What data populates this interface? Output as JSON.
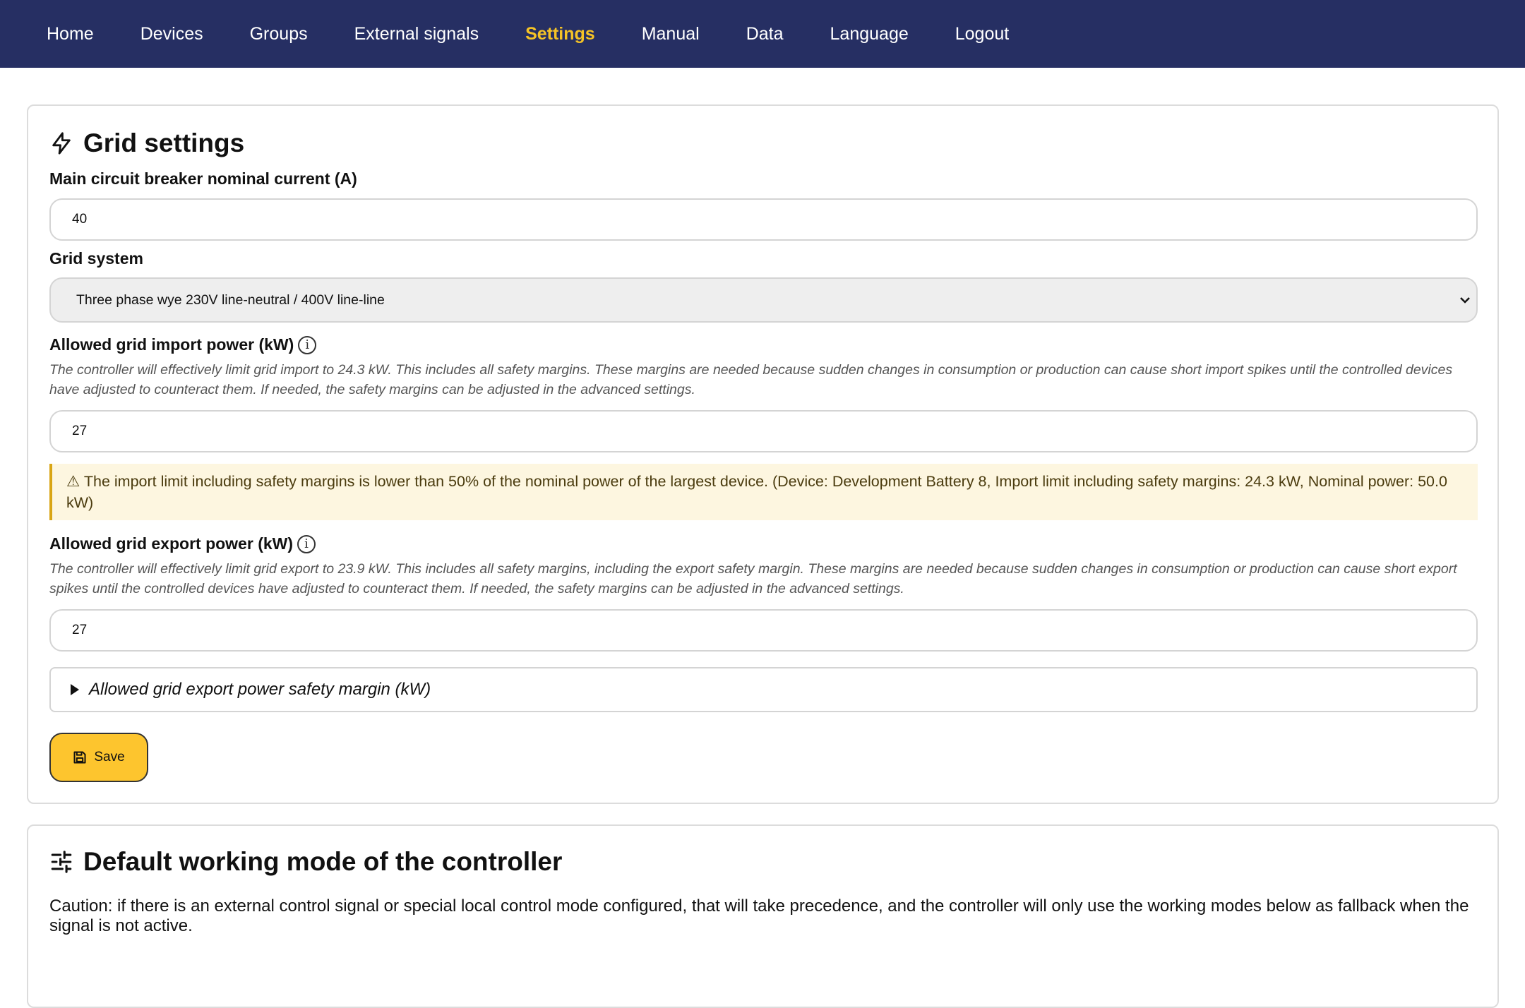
{
  "nav": {
    "items": [
      {
        "label": "Home"
      },
      {
        "label": "Devices"
      },
      {
        "label": "Groups"
      },
      {
        "label": "External signals"
      },
      {
        "label": "Settings",
        "active": true
      },
      {
        "label": "Manual"
      },
      {
        "label": "Data"
      },
      {
        "label": "Language"
      },
      {
        "label": "Logout"
      }
    ]
  },
  "grid_settings": {
    "title": "Grid settings",
    "title_icon": "lightning-bolt-icon",
    "breaker": {
      "label": "Main circuit breaker nominal current (A)",
      "value": "40"
    },
    "grid_system": {
      "label": "Grid system",
      "selected": "Three phase wye 230V line-neutral / 400V line-line"
    },
    "import": {
      "label": "Allowed grid import power (kW)",
      "help": "The controller will effectively limit grid import to 24.3 kW. This includes all safety margins. These margins are needed because sudden changes in consumption or production can cause short import spikes until the controlled devices have adjusted to counteract them. If needed, the safety margins can be adjusted in the advanced settings.",
      "value": "27",
      "warning": "⚠ The import limit including safety margins is lower than 50% of the nominal power of the largest device. (Device: Development Battery 8, Import limit including safety margins: 24.3 kW, Nominal power: 50.0 kW)"
    },
    "export": {
      "label": "Allowed grid export power (kW)",
      "help": "The controller will effectively limit grid export to 23.9 kW. This includes all safety margins, including the export safety margin. These margins are needed because sudden changes in consumption or production can cause short export spikes until the controlled devices have adjusted to counteract them. If needed, the safety margins can be adjusted in the advanced settings.",
      "value": "27",
      "safety_margin_summary": "Allowed grid export power safety margin (kW)"
    },
    "save_label": "Save"
  },
  "working_mode": {
    "title": "Default working mode of the controller",
    "title_icon": "sliders-icon",
    "caution": "Caution: if there is an external control signal or special local control mode configured, that will take precedence, and the controller will only use the working modes below as fallback when the signal is not active."
  },
  "colors": {
    "nav_bg": "#262f63",
    "nav_active": "#f5c326",
    "save_bg": "#fdc52e",
    "warning_bg": "#fdf6e0"
  }
}
